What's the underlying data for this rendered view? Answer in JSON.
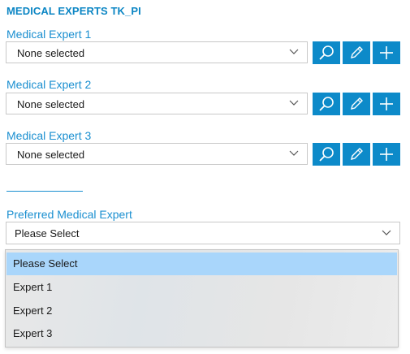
{
  "section": {
    "title": "MEDICAL EXPERTS TK_PI"
  },
  "experts": [
    {
      "label": "Medical Expert 1",
      "value": "None selected"
    },
    {
      "label": "Medical Expert 2",
      "value": "None selected"
    },
    {
      "label": "Medical Expert 3",
      "value": "None selected"
    }
  ],
  "icons": {
    "search": "search-icon",
    "edit": "pencil-icon",
    "add": "plus-icon",
    "chevron": "chevron-down-icon"
  },
  "colors": {
    "accent": "#0d8ac9",
    "label": "#1a8fd0",
    "highlight": "#a9d6fb"
  },
  "preferred": {
    "label": "Preferred Medical Expert",
    "value": "Please Select",
    "options": [
      "Please Select",
      "Expert 1",
      "Expert 2",
      "Expert 3"
    ]
  }
}
